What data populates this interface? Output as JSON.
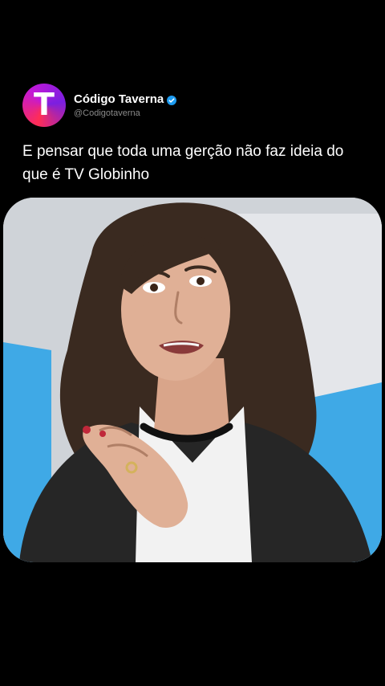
{
  "post": {
    "author": {
      "display_name": "Código Taverna",
      "handle": "@Codigotaverna",
      "avatar_letter": "T",
      "verified": true
    },
    "text": "E pensar que toda uma gerção não faz ideia do que é TV Globinho",
    "media": {
      "type": "video-frame",
      "alt_icon": "person-talking"
    }
  },
  "colors": {
    "background": "#000000",
    "text": "#ffffff",
    "handle": "#8a8a8a",
    "verified": "#1d9bf0",
    "avatar_gradient": [
      "#ff2d55",
      "#c218d8",
      "#7b1fe0"
    ],
    "accent_blue": "#3fa9e6"
  }
}
